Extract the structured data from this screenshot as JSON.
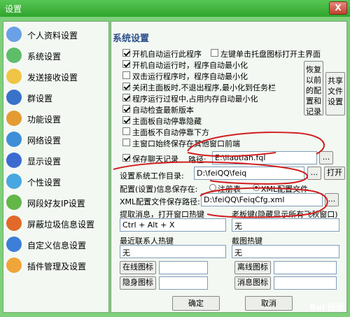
{
  "window": {
    "title": "设置",
    "close_label": "X"
  },
  "sidebar": {
    "items": [
      {
        "label": "个人资料设置",
        "icon": "profile-icon",
        "color": "#6aa0e6"
      },
      {
        "label": "系统设置",
        "icon": "system-icon",
        "color": "#5ebd69"
      },
      {
        "label": "发送接收设置",
        "icon": "send-receive-icon",
        "color": "#f0c545"
      },
      {
        "label": "群设置",
        "icon": "group-icon",
        "color": "#3a72c9"
      },
      {
        "label": "功能设置",
        "icon": "function-icon",
        "color": "#e59b33"
      },
      {
        "label": "网络设置",
        "icon": "network-icon",
        "color": "#3f8ed8"
      },
      {
        "label": "显示设置",
        "icon": "display-icon",
        "color": "#3b6bd1"
      },
      {
        "label": "个性设置",
        "icon": "personalize-icon",
        "color": "#48a7e0"
      },
      {
        "label": "网段好友IP设置",
        "icon": "ip-icon",
        "color": "#62b748"
      },
      {
        "label": "屏蔽垃圾信息设置",
        "icon": "block-spam-icon",
        "color": "#e16a2a"
      },
      {
        "label": "自定义信息设置",
        "icon": "custom-info-icon",
        "color": "#3c7ed8"
      },
      {
        "label": "插件管理及设置",
        "icon": "plugin-icon",
        "color": "#f0a53a"
      }
    ]
  },
  "panel": {
    "title": "系统设置",
    "options": [
      {
        "label": "开机自动运行此程序",
        "checked": true
      },
      {
        "label": "左键单击托盘图标打开主界面",
        "checked": false
      },
      {
        "label": "开机自动运行时，程序自动最小化",
        "checked": true
      },
      {
        "label": "双击运行程序时，程序自动最小化",
        "checked": false
      },
      {
        "label": "关闭主面板时,不退出程序,最小化到任务栏",
        "checked": true
      },
      {
        "label": "程序运行过程中,占用内存自动最小化",
        "checked": true
      },
      {
        "label": "自动检查最新版本",
        "checked": true
      },
      {
        "label": "主面板自动停靠隐藏",
        "checked": true
      },
      {
        "label": "主面板不自动停靠下方",
        "checked": false
      },
      {
        "label": "主窗口始终保存在其他窗口前端",
        "checked": false
      },
      {
        "label": "保存聊天记录",
        "checked": true
      }
    ],
    "restore_button": "恢复以前的配置和记录",
    "share_button": "共享文件设置",
    "log_path_label": "路径:",
    "log_path_value": "E:\\liaotian.fql",
    "browse_label": "...",
    "workdir_label": "设置系统工作目录:",
    "workdir_value": "D:\\feiQQ\\feiq",
    "open_label": "打开",
    "config_save_label": "配置(设置)信息保存在:",
    "radio_registry": "注册表",
    "radio_xml": "XML配置文件",
    "xml_path_label": "XML配置文件保存路径:",
    "xml_path_value": "D:\\feiQQ\\FeiqCfg.xml",
    "hotkey_extract_label": "提取消息，打开窗口热键",
    "hotkey_extract_value": "Ctrl + Alt + X",
    "hotkey_boss_label": "老板键(隐藏显示所有飞秋窗口)",
    "hotkey_boss_value": "无",
    "hotkey_recent_label": "最近联系人热键",
    "hotkey_recent_value": "无",
    "hotkey_screenshot_label": "截图热键",
    "hotkey_screenshot_value": "无",
    "online_icon_label": "在线图标",
    "offline_icon_label": "离线图标",
    "hidden_icon_label": "隐身图标",
    "message_icon_label": "消息图标",
    "ok_label": "确定",
    "cancel_label": "取消"
  },
  "watermark": "Bai 经验"
}
